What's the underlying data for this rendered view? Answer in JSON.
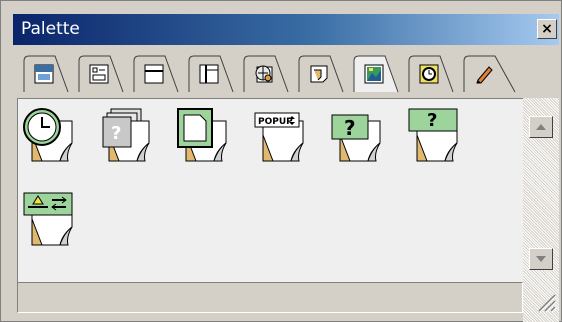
{
  "window": {
    "title": "Palette",
    "close_glyph": "×"
  },
  "tabs": [
    {
      "icon": "browser-layout-icon"
    },
    {
      "icon": "form-field-icon"
    },
    {
      "icon": "header-frame-icon"
    },
    {
      "icon": "sidebar-frame-icon"
    },
    {
      "icon": "globe-icon"
    },
    {
      "icon": "page-tag-icon"
    },
    {
      "icon": "image-icon",
      "selected": true
    },
    {
      "icon": "media-clock-icon"
    },
    {
      "icon": "pencil-icon"
    }
  ],
  "objects": [
    {
      "icon": "clock-object-icon"
    },
    {
      "icon": "placeholder-object-icon"
    },
    {
      "icon": "document-object-icon"
    },
    {
      "icon": "popup-object-icon",
      "label": "POPUP"
    },
    {
      "icon": "help-object-icon",
      "label": "?"
    },
    {
      "icon": "help-tag-object-icon",
      "label": "?"
    },
    {
      "icon": "warning-action-object-icon"
    }
  ],
  "colors": {
    "title_start": "#0a246a",
    "title_end": "#a6caf0",
    "chrome": "#d4d0c8",
    "page_green": "#9cd49c"
  }
}
